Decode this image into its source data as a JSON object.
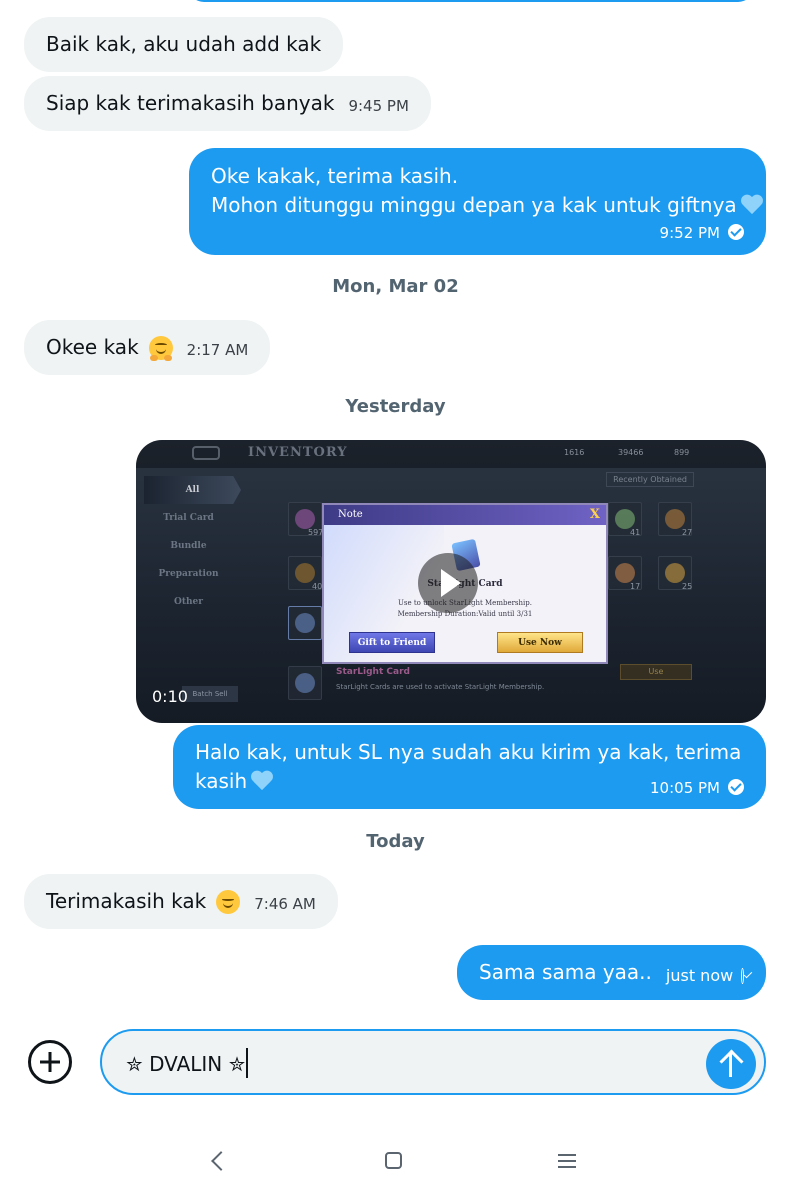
{
  "messages": {
    "m1": {
      "text": "Baik kak, aku udah add kak"
    },
    "m2": {
      "text": "Siap kak terimakasih banyak",
      "time": "9:45 PM"
    },
    "m3": {
      "line1": "Oke kakak, terima kasih.",
      "line2": "Mohon ditunggu minggu depan ya kak untuk giftnya",
      "time": "9:52 PM"
    },
    "m4": {
      "text": "Okee kak",
      "emoji": "hugging-face-emoji",
      "time": "2:17 AM"
    },
    "m5": {
      "line1": "Halo kak, untuk SL nya sudah aku kirim ya kak, terima",
      "line2": "kasih",
      "time": "10:05 PM"
    },
    "m6": {
      "text": "Terimakasih kak",
      "emoji": "smiling-face-emoji",
      "time": "7:46 AM"
    },
    "m7": {
      "text": "Sama sama yaa..",
      "time": "just now"
    }
  },
  "date_separators": {
    "d1": "Mon, Mar 02",
    "d2": "Yesterday",
    "d3": "Today"
  },
  "video": {
    "duration": "0:10",
    "screen_title": "INVENTORY",
    "stats": [
      "1616",
      "39466",
      "899"
    ],
    "recently_obtained": "Recently Obtained",
    "tabs": [
      "All",
      "Trial Card",
      "Bundle",
      "Preparation",
      "Other"
    ],
    "slot_counts": [
      "597",
      "41",
      "27",
      "40",
      "17",
      "25"
    ],
    "dialog": {
      "title": "Note",
      "close": "X",
      "item": "StarLight Card",
      "desc1": "Use to unlock StarLight Membership.",
      "desc2": "Membership Duration:Valid until 3/31",
      "gift_btn": "Gift to Friend",
      "use_btn": "Use Now"
    },
    "item_name": "StarLight Card",
    "item_desc": "StarLight Cards are used to activate StarLight Membership.",
    "use_label": "Use",
    "batch_label": "Batch Sell"
  },
  "composer": {
    "value": "✮ DVALIN ✮"
  },
  "icons": {
    "add": "add-circle-icon",
    "send": "send-arrow-icon",
    "read_receipt": "check-circle-icon",
    "sent_receipt": "check-circle-outline-icon",
    "heart": "light-blue-heart-icon",
    "nav": [
      "back-icon",
      "home-icon",
      "menu-icon"
    ]
  },
  "colors": {
    "accent": "#1d9bf0",
    "incoming_bubble": "#eff3f4",
    "separator_text": "#536471"
  }
}
